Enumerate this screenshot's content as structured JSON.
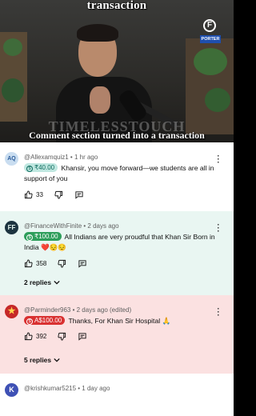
{
  "video": {
    "title": "transaction",
    "watermark": "TIMELESSTOUCH",
    "caption": "Comment section turned into a transaction",
    "channel_badge": "F",
    "sponsor_badge": "PORTER"
  },
  "comments": [
    {
      "username": "@Allexamquiz1",
      "time": "1 hr ago",
      "tip": "₹40.00",
      "text": "Khansir, you move forward—we students are all in support of you",
      "likes": "33",
      "replies": ""
    },
    {
      "username": "@FinanceWithFinite",
      "time": "2 days ago",
      "tip": "₹100.00",
      "text": "All Indians are very proudful that Khan Sir Born in India ❤️😔😔",
      "likes": "358",
      "replies": "2 replies"
    },
    {
      "username": "@Parminder963",
      "time": "2 days ago (edited)",
      "tip": "A$100.00",
      "text": "Thanks, For Khan Sir Hospital 🙏",
      "likes": "392",
      "replies": "5 replies"
    },
    {
      "username": "@krishkumar5215",
      "time": "1 day ago",
      "tip": "",
      "text": "",
      "likes": "",
      "replies": ""
    }
  ],
  "avatars": [
    "AQ",
    "FF",
    "★",
    "K"
  ],
  "separator": " • ",
  "colors": {
    "tip_green": "#2e9e5b",
    "tip_red": "#d93131",
    "highlight_green": "#e9f6f2",
    "highlight_red": "#fbe1e1"
  },
  "icons": [
    "like-icon",
    "dislike-icon",
    "reply-icon",
    "more-options-icon",
    "chevron-down-icon",
    "tip-icon"
  ]
}
